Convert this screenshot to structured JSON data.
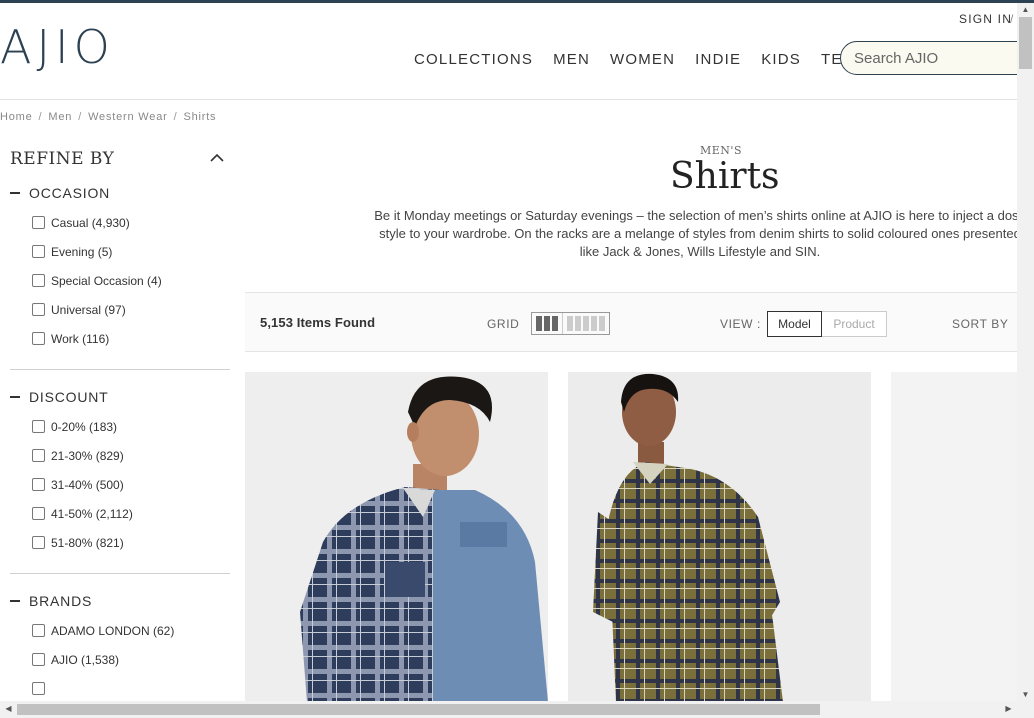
{
  "header": {
    "logo": "AJIO",
    "signin": "SIGN IN",
    "signin_sep": "/",
    "nav": [
      "COLLECTIONS",
      "MEN",
      "WOMEN",
      "INDIE",
      "KIDS",
      "TECH"
    ],
    "search_placeholder": "Search AJIO"
  },
  "breadcrumb": [
    "Home",
    "Men",
    "Western Wear",
    "Shirts"
  ],
  "sidebar": {
    "title": "REFINE BY",
    "facets": [
      {
        "title": "OCCASION",
        "options": [
          "Casual (4,930)",
          "Evening (5)",
          "Special Occasion (4)",
          "Universal (97)",
          "Work (116)"
        ]
      },
      {
        "title": "DISCOUNT",
        "options": [
          "0-20% (183)",
          "21-30% (829)",
          "31-40% (500)",
          "41-50% (2,112)",
          "51-80% (821)"
        ]
      },
      {
        "title": "BRANDS",
        "options": [
          "ADAMO LONDON (62)",
          "AJIO (1,538)"
        ]
      }
    ]
  },
  "category": {
    "subtitle": "MEN'S",
    "title": "Shirts",
    "description": [
      "Be it Monday meetings or Saturday evenings – the selection of men’s shirts online at AJIO is here to inject a dose",
      "style to your wardrobe. On the racks are a melange of styles from denim shirts to solid coloured ones presented",
      "like Jack & Jones, Wills Lifestyle and SIN."
    ]
  },
  "toolbar": {
    "items_found": "5,153 Items Found",
    "grid_label": "GRID",
    "view_label": "VIEW :",
    "view_model": "Model",
    "view_product": "Product",
    "sort_label": "SORT BY"
  },
  "colors": {
    "brand": "#2c4152",
    "product_bg": "#f1f1f1"
  },
  "scrollbar_icons": {
    "up": "▲",
    "down": "▼",
    "left": "◀",
    "right": "▶"
  }
}
